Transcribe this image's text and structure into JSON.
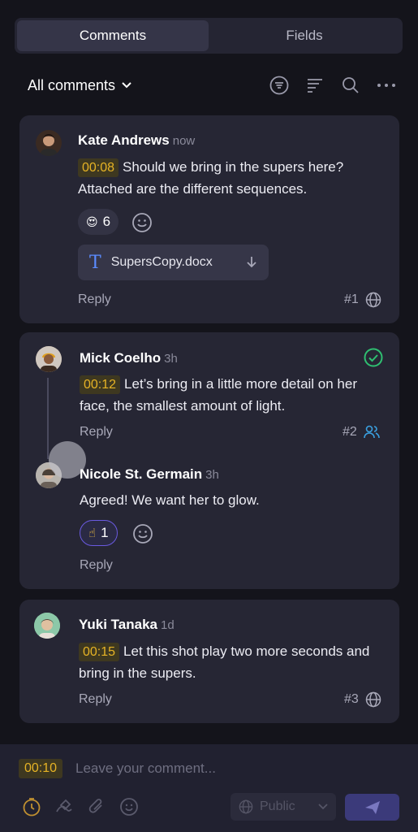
{
  "tabs": [
    {
      "label": "Comments",
      "active": true
    },
    {
      "label": "Fields",
      "active": false
    }
  ],
  "filter": {
    "label": "All comments"
  },
  "icons": {
    "filter": "filter-circle-icon",
    "sort": "sort-lines-icon",
    "search": "search-icon",
    "more": "more-dots-icon"
  },
  "comments": [
    {
      "author": "Kate Andrews",
      "time": "now",
      "timecode": "00:08",
      "text": "Should we bring in the supers here? Attached are the different sequences.",
      "reaction": {
        "emoji": "😍",
        "count": "6"
      },
      "attachment": {
        "name": "SupersCopy.docx"
      },
      "reply": "Reply",
      "number": "#1",
      "visibility_icon": "globe-icon"
    },
    {
      "author": "Mick Coelho",
      "time": "3h",
      "timecode": "00:12",
      "text": "Let’s bring in a little more detail on her face, the smallest amount of light.",
      "resolved": true,
      "reply": "Reply",
      "number": "#2",
      "visibility_icon": "people-icon",
      "reply_item": {
        "author": "Nicole St. Germain",
        "time": "3h",
        "text": "Agreed! We want her to glow.",
        "reaction": {
          "emoji": "☝",
          "count": "1"
        },
        "reply": "Reply"
      }
    },
    {
      "author": "Yuki Tanaka",
      "time": "1d",
      "timecode": "00:15",
      "text": "Let this shot play two more seconds and bring in the supers.",
      "reply": "Reply",
      "number": "#3",
      "visibility_icon": "globe-icon"
    }
  ],
  "composer": {
    "timecode": "00:10",
    "placeholder": "Leave your comment...",
    "visibility": "Public"
  },
  "colors": {
    "accent": "#e6b325",
    "resolved": "#2fbf71",
    "send": "#3b3a7a"
  }
}
